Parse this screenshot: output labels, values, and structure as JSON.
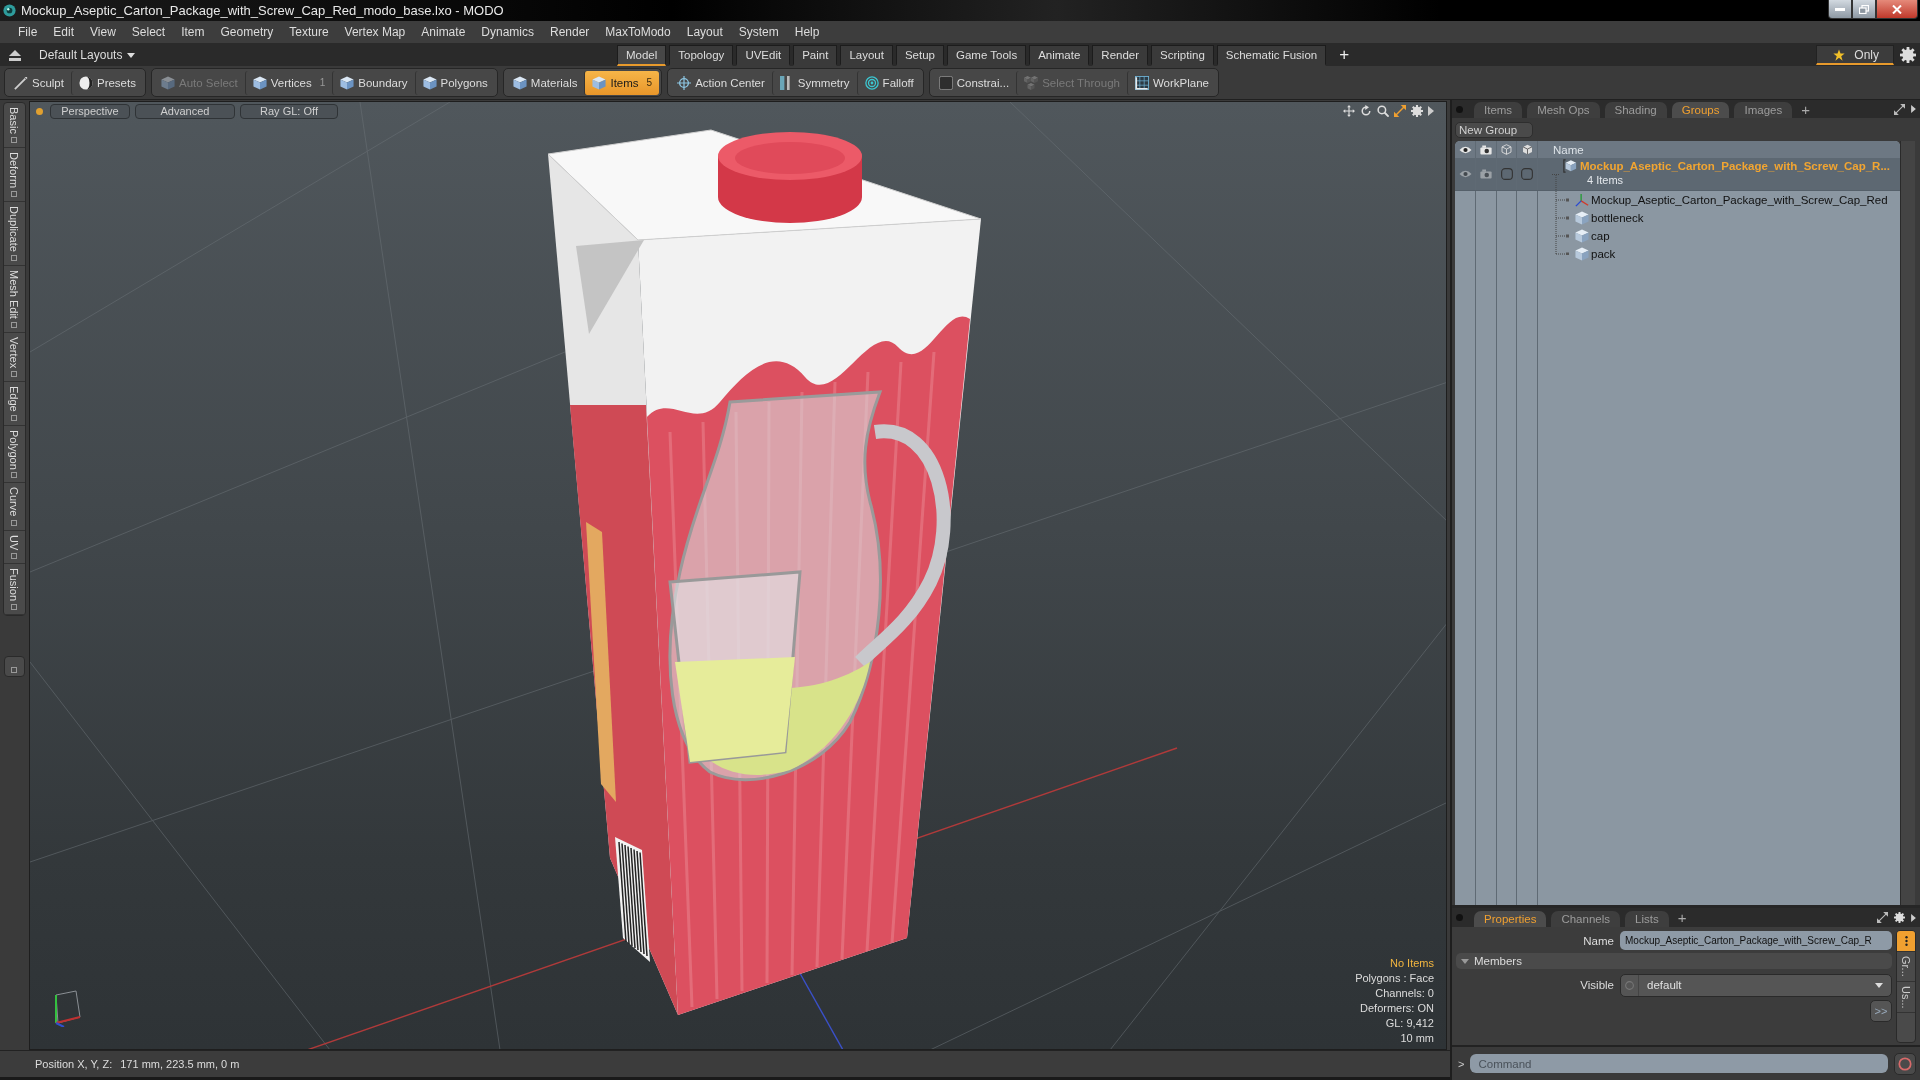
{
  "window": {
    "title": "Mockup_Aseptic_Carton_Package_with_Screw_Cap_Red_modo_base.lxo - MODO"
  },
  "menu_bar": [
    "File",
    "Edit",
    "View",
    "Select",
    "Item",
    "Geometry",
    "Texture",
    "Vertex Map",
    "Animate",
    "Dynamics",
    "Render",
    "MaxToModo",
    "Layout",
    "System",
    "Help"
  ],
  "layout_bar": {
    "layouts_dropdown": "Default Layouts",
    "tabs": [
      {
        "label": "Model",
        "selected": true
      },
      {
        "label": "Topology",
        "selected": false
      },
      {
        "label": "UVEdit",
        "selected": false
      },
      {
        "label": "Paint",
        "selected": false
      },
      {
        "label": "Layout",
        "selected": false
      },
      {
        "label": "Setup",
        "selected": false
      },
      {
        "label": "Game Tools",
        "selected": false
      },
      {
        "label": "Animate",
        "selected": false
      },
      {
        "label": "Render",
        "selected": false
      },
      {
        "label": "Scripting",
        "selected": false
      },
      {
        "label": "Schematic Fusion",
        "selected": false
      }
    ],
    "add_tab": "+",
    "only_toggle": {
      "label": "Only",
      "on": true
    }
  },
  "toolbar": [
    {
      "items": [
        {
          "label": "Sculpt",
          "selected": false,
          "disabled": false
        },
        {
          "label": "Presets",
          "selected": false,
          "disabled": false
        }
      ]
    },
    {
      "items": [
        {
          "label": "Auto Select",
          "selected": false,
          "disabled": true
        },
        {
          "label": "Vertices",
          "count": "1",
          "selected": false,
          "disabled": false
        },
        {
          "label": "Boundary",
          "selected": false,
          "disabled": false
        },
        {
          "label": "Polygons",
          "selected": false,
          "disabled": false
        }
      ]
    },
    {
      "items": [
        {
          "label": "Materials",
          "selected": false,
          "disabled": false
        },
        {
          "label": "Items",
          "count": "5",
          "selected": true,
          "disabled": false
        }
      ]
    },
    {
      "items": [
        {
          "label": "Action Center",
          "selected": false,
          "disabled": false
        },
        {
          "label": "Symmetry",
          "selected": false,
          "disabled": false
        },
        {
          "label": "Falloff",
          "selected": false,
          "disabled": false
        }
      ]
    },
    {
      "items": [
        {
          "label": "Constrai...",
          "selected": false,
          "disabled": false
        },
        {
          "label": "Select Through",
          "selected": false,
          "disabled": true
        },
        {
          "label": "WorkPlane",
          "selected": false,
          "disabled": false
        }
      ]
    }
  ],
  "left_tabs": [
    "Basic",
    "Deform",
    "Duplicate",
    "Mesh Edit",
    "Vertex",
    "Edge",
    "Polygon",
    "Curve",
    "UV",
    "Fusion"
  ],
  "viewport": {
    "view_buttons": [
      "Perspective",
      "Advanced",
      "Ray GL: Off"
    ],
    "info": [
      {
        "text": "No Items",
        "kind": "highlight"
      },
      {
        "text": "Polygons : Face",
        "kind": "plain"
      },
      {
        "text": "Channels: 0",
        "kind": "plain"
      },
      {
        "text": "Deformers: ON",
        "kind": "plain"
      },
      {
        "text": "GL: 9,412",
        "kind": "plain"
      },
      {
        "text": "10 mm",
        "kind": "plain"
      }
    ]
  },
  "status_bar": {
    "label": "Position X, Y, Z:",
    "value": "171 mm, 223.5 mm, 0 m"
  },
  "items_panel": {
    "tabs": [
      {
        "label": "Items",
        "selected": false
      },
      {
        "label": "Mesh Ops",
        "selected": false
      },
      {
        "label": "Shading",
        "selected": false
      },
      {
        "label": "Groups",
        "selected": true
      },
      {
        "label": "Images",
        "selected": false
      }
    ],
    "add_tab": "+",
    "new_group_button": "New Group",
    "columns": [
      "Name"
    ],
    "groups": [
      {
        "name": "Mockup_Aseptic_Carton_Package_with_Screw_Cap_R...",
        "count": "4 Items",
        "selected": true,
        "children": [
          {
            "name": "Mockup_Aseptic_Carton_Package_with_Screw_Cap_Red",
            "kind": "locator",
            "selected": false
          },
          {
            "name": "bottleneck",
            "kind": "mesh",
            "selected": false
          },
          {
            "name": "cap",
            "kind": "mesh",
            "selected": false
          },
          {
            "name": "pack",
            "kind": "mesh",
            "selected": false
          }
        ]
      }
    ]
  },
  "properties_panel": {
    "tabs": [
      {
        "label": "Properties",
        "selected": true
      },
      {
        "label": "Channels",
        "selected": false
      },
      {
        "label": "Lists",
        "selected": false
      }
    ],
    "add_tab": "+",
    "name_label": "Name",
    "name_value": "Mockup_Aseptic_Carton_Package_with_Screw_Cap_R",
    "section": {
      "label": "Members",
      "expanded": true
    },
    "visible_label": "Visible",
    "visible_value": "default",
    "more_button": ">>",
    "side_tabs": [
      {
        "kind": "menu",
        "selected": true
      },
      {
        "kind": "label",
        "label": "Gr...",
        "selected": false
      },
      {
        "kind": "label",
        "label": "Us...",
        "selected": false
      }
    ]
  },
  "command_line": {
    "prompt": ">",
    "placeholder": "Command"
  }
}
